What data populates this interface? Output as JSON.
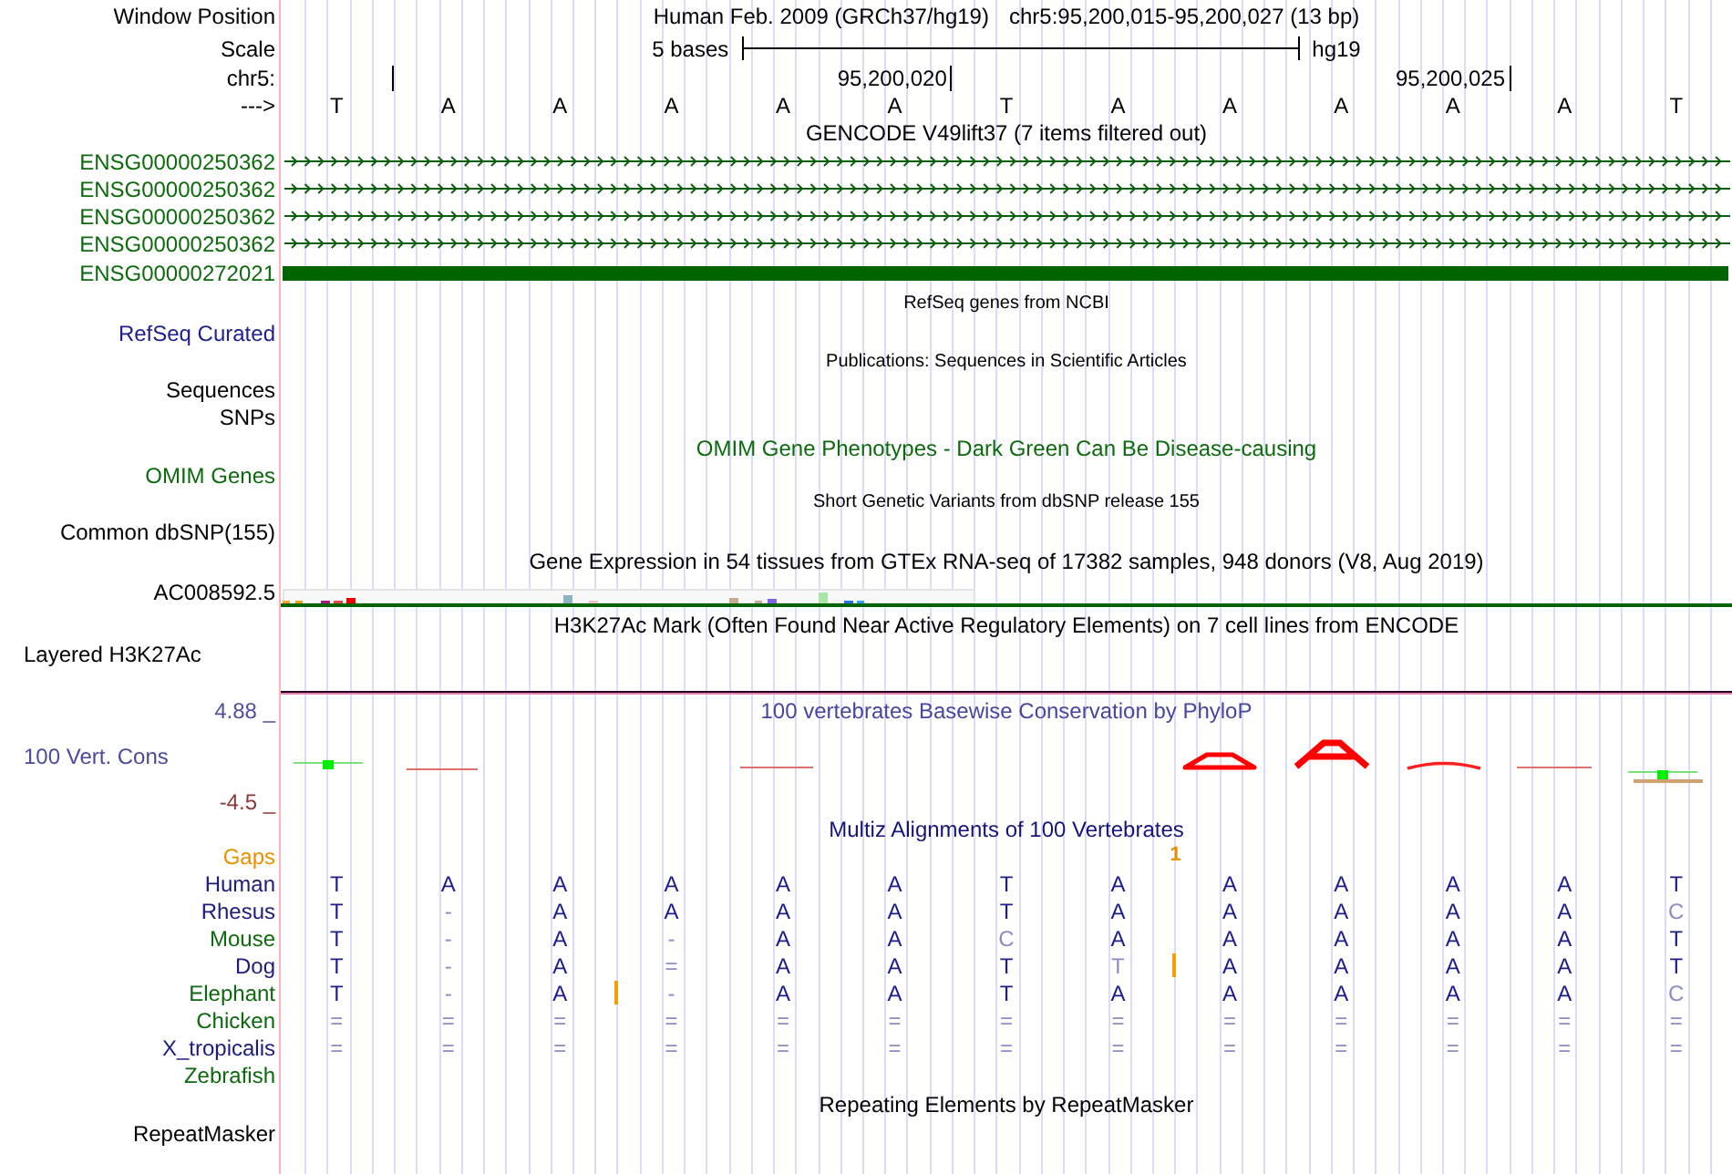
{
  "position": {
    "label": "Window Position",
    "assembly": "Human Feb. 2009 (GRCh37/hg19)",
    "range": "chr5:95,200,015-95,200,027 (13 bp)"
  },
  "scale": {
    "label": "Scale",
    "span": "5 bases",
    "assembly": "hg19"
  },
  "ruler": {
    "label": "chr5:"
  },
  "sequence": {
    "label": "--->",
    "bases": [
      {
        "base": "T",
        "tick": true
      },
      {
        "base": "A",
        "tick": false
      },
      {
        "base": "A",
        "tick": false
      },
      {
        "base": "A",
        "tick": false
      },
      {
        "base": "A",
        "tick": false
      },
      {
        "base": "A",
        "tick": true,
        "tick_label": "95,200,020"
      },
      {
        "base": "T",
        "tick": false
      },
      {
        "base": "A",
        "tick": false
      },
      {
        "base": "A",
        "tick": false
      },
      {
        "base": "A",
        "tick": false
      },
      {
        "base": "A",
        "tick": true,
        "tick_label": "95,200,025"
      },
      {
        "base": "A",
        "tick": false
      },
      {
        "base": "T",
        "tick": false
      }
    ]
  },
  "gencode": {
    "title": "GENCODE V49lift37 (7 items filtered out)",
    "genes": [
      {
        "name": "ENSG00000250362",
        "kind": "intron"
      },
      {
        "name": "ENSG00000250362",
        "kind": "intron"
      },
      {
        "name": "ENSG00000250362",
        "kind": "intron"
      },
      {
        "name": "ENSG00000250362",
        "kind": "intron"
      },
      {
        "name": "ENSG00000272021",
        "kind": "exon"
      }
    ]
  },
  "refseq": {
    "title": "RefSeq genes from NCBI",
    "label": "RefSeq Curated"
  },
  "publications": {
    "title": "Publications: Sequences in Scientific Articles",
    "labels": [
      "Sequences",
      "SNPs"
    ]
  },
  "omim": {
    "title": "OMIM Gene Phenotypes - Dark Green Can Be Disease-causing",
    "label": "OMIM Genes"
  },
  "dbsnp": {
    "title": "Short Genetic Variants from dbSNP release 155",
    "label": "Common dbSNP(155)"
  },
  "gtex": {
    "title": "Gene Expression in 54 tissues from GTEx RNA-seq of 17382 samples, 948 donors (V8, Aug 2019)",
    "label": "AC008592.5"
  },
  "h3k27ac": {
    "title": "H3K27Ac Mark (Often Found Near Active Regulatory Elements) on 7 cell lines from ENCODE",
    "label": "Layered H3K27Ac"
  },
  "conservation": {
    "title": "100 vertebrates Basewise Conservation by PhyloP",
    "label": "100 Vert. Cons",
    "max_label": "4.88 _",
    "min_label": "-4.5 _"
  },
  "multiz": {
    "title": "Multiz Alignments of 100 Vertebrates",
    "gaps": {
      "label": "Gaps",
      "cells": [
        {
          "kind": "none"
        },
        {
          "kind": "none"
        },
        {
          "kind": "none"
        },
        {
          "kind": "none"
        },
        {
          "kind": "none"
        },
        {
          "kind": "none"
        },
        {
          "kind": "none"
        },
        {
          "kind": "insert",
          "count": "1"
        },
        {
          "kind": "none"
        },
        {
          "kind": "none"
        },
        {
          "kind": "none"
        },
        {
          "kind": "none"
        },
        {
          "kind": "none"
        }
      ]
    },
    "species": [
      {
        "name": "Human",
        "color": "#1c1c7c",
        "cells": [
          {
            "base": "T",
            "match": true,
            "insert": false
          },
          {
            "base": "A",
            "match": true,
            "insert": false
          },
          {
            "base": "A",
            "match": true,
            "insert": false
          },
          {
            "base": "A",
            "match": true,
            "insert": false
          },
          {
            "base": "A",
            "match": true,
            "insert": false
          },
          {
            "base": "A",
            "match": true,
            "insert": false
          },
          {
            "base": "T",
            "match": true,
            "insert": false
          },
          {
            "base": "A",
            "match": true,
            "insert": false
          },
          {
            "base": "A",
            "match": true,
            "insert": false
          },
          {
            "base": "A",
            "match": true,
            "insert": false
          },
          {
            "base": "A",
            "match": true,
            "insert": false
          },
          {
            "base": "A",
            "match": true,
            "insert": false
          },
          {
            "base": "T",
            "match": true,
            "insert": false
          }
        ]
      },
      {
        "name": "Rhesus",
        "color": "#1c1c7c",
        "cells": [
          {
            "base": "T",
            "match": true,
            "insert": false
          },
          {
            "base": "-",
            "match": false,
            "insert": false
          },
          {
            "base": "A",
            "match": true,
            "insert": false
          },
          {
            "base": "A",
            "match": true,
            "insert": false
          },
          {
            "base": "A",
            "match": true,
            "insert": false
          },
          {
            "base": "A",
            "match": true,
            "insert": false
          },
          {
            "base": "T",
            "match": true,
            "insert": false
          },
          {
            "base": "A",
            "match": true,
            "insert": false
          },
          {
            "base": "A",
            "match": true,
            "insert": false
          },
          {
            "base": "A",
            "match": true,
            "insert": false
          },
          {
            "base": "A",
            "match": true,
            "insert": false
          },
          {
            "base": "A",
            "match": true,
            "insert": false
          },
          {
            "base": "C",
            "match": false,
            "insert": false
          }
        ]
      },
      {
        "name": "Mouse",
        "color": "#0d690d",
        "cells": [
          {
            "base": "T",
            "match": true,
            "insert": false
          },
          {
            "base": "-",
            "match": false,
            "insert": false
          },
          {
            "base": "A",
            "match": true,
            "insert": false
          },
          {
            "base": "-",
            "match": false,
            "insert": false
          },
          {
            "base": "A",
            "match": true,
            "insert": false
          },
          {
            "base": "A",
            "match": true,
            "insert": false
          },
          {
            "base": "C",
            "match": false,
            "insert": false
          },
          {
            "base": "A",
            "match": true,
            "insert": false
          },
          {
            "base": "A",
            "match": true,
            "insert": false
          },
          {
            "base": "A",
            "match": true,
            "insert": false
          },
          {
            "base": "A",
            "match": true,
            "insert": false
          },
          {
            "base": "A",
            "match": true,
            "insert": false
          },
          {
            "base": "T",
            "match": true,
            "insert": false
          }
        ]
      },
      {
        "name": "Dog",
        "color": "#1c1c7c",
        "cells": [
          {
            "base": "T",
            "match": true,
            "insert": false
          },
          {
            "base": "-",
            "match": false,
            "insert": false
          },
          {
            "base": "A",
            "match": true,
            "insert": false
          },
          {
            "base": "=",
            "match": false,
            "insert": false
          },
          {
            "base": "A",
            "match": true,
            "insert": false
          },
          {
            "base": "A",
            "match": true,
            "insert": false
          },
          {
            "base": "T",
            "match": true,
            "insert": false
          },
          {
            "base": "T",
            "match": false,
            "insert": true
          },
          {
            "base": "A",
            "match": true,
            "insert": false
          },
          {
            "base": "A",
            "match": true,
            "insert": false
          },
          {
            "base": "A",
            "match": true,
            "insert": false
          },
          {
            "base": "A",
            "match": true,
            "insert": false
          },
          {
            "base": "T",
            "match": true,
            "insert": false
          }
        ]
      },
      {
        "name": "Elephant",
        "color": "#0d690d",
        "cells": [
          {
            "base": "T",
            "match": true,
            "insert": false
          },
          {
            "base": "-",
            "match": false,
            "insert": false
          },
          {
            "base": "A",
            "match": true,
            "insert": true
          },
          {
            "base": "-",
            "match": false,
            "insert": false
          },
          {
            "base": "A",
            "match": true,
            "insert": false
          },
          {
            "base": "A",
            "match": true,
            "insert": false
          },
          {
            "base": "T",
            "match": true,
            "insert": false
          },
          {
            "base": "A",
            "match": true,
            "insert": false
          },
          {
            "base": "A",
            "match": true,
            "insert": false
          },
          {
            "base": "A",
            "match": true,
            "insert": false
          },
          {
            "base": "A",
            "match": true,
            "insert": false
          },
          {
            "base": "A",
            "match": true,
            "insert": false
          },
          {
            "base": "C",
            "match": false,
            "insert": false
          }
        ]
      },
      {
        "name": "Chicken",
        "color": "#0d690d",
        "cells": [
          {
            "base": "=",
            "match": false,
            "insert": false
          },
          {
            "base": "=",
            "match": false,
            "insert": false
          },
          {
            "base": "=",
            "match": false,
            "insert": false
          },
          {
            "base": "=",
            "match": false,
            "insert": false
          },
          {
            "base": "=",
            "match": false,
            "insert": false
          },
          {
            "base": "=",
            "match": false,
            "insert": false
          },
          {
            "base": "=",
            "match": false,
            "insert": false
          },
          {
            "base": "=",
            "match": false,
            "insert": false
          },
          {
            "base": "=",
            "match": false,
            "insert": false
          },
          {
            "base": "=",
            "match": false,
            "insert": false
          },
          {
            "base": "=",
            "match": false,
            "insert": false
          },
          {
            "base": "=",
            "match": false,
            "insert": false
          },
          {
            "base": "=",
            "match": false,
            "insert": false
          }
        ]
      },
      {
        "name": "X_tropicalis",
        "color": "#1c1c7c",
        "cells": [
          {
            "base": "=",
            "match": false,
            "insert": false
          },
          {
            "base": "=",
            "match": false,
            "insert": false
          },
          {
            "base": "=",
            "match": false,
            "insert": false
          },
          {
            "base": "=",
            "match": false,
            "insert": false
          },
          {
            "base": "=",
            "match": false,
            "insert": false
          },
          {
            "base": "=",
            "match": false,
            "insert": false
          },
          {
            "base": "=",
            "match": false,
            "insert": false
          },
          {
            "base": "=",
            "match": false,
            "insert": false
          },
          {
            "base": "=",
            "match": false,
            "insert": false
          },
          {
            "base": "=",
            "match": false,
            "insert": false
          },
          {
            "base": "=",
            "match": false,
            "insert": false
          },
          {
            "base": "=",
            "match": false,
            "insert": false
          },
          {
            "base": "=",
            "match": false,
            "insert": false
          }
        ]
      },
      {
        "name": "Zebrafish",
        "color": "#0d690d"
      }
    ]
  },
  "repeatmasker": {
    "title": "Repeating Elements by RepeatMasker",
    "label": "RepeatMasker"
  }
}
